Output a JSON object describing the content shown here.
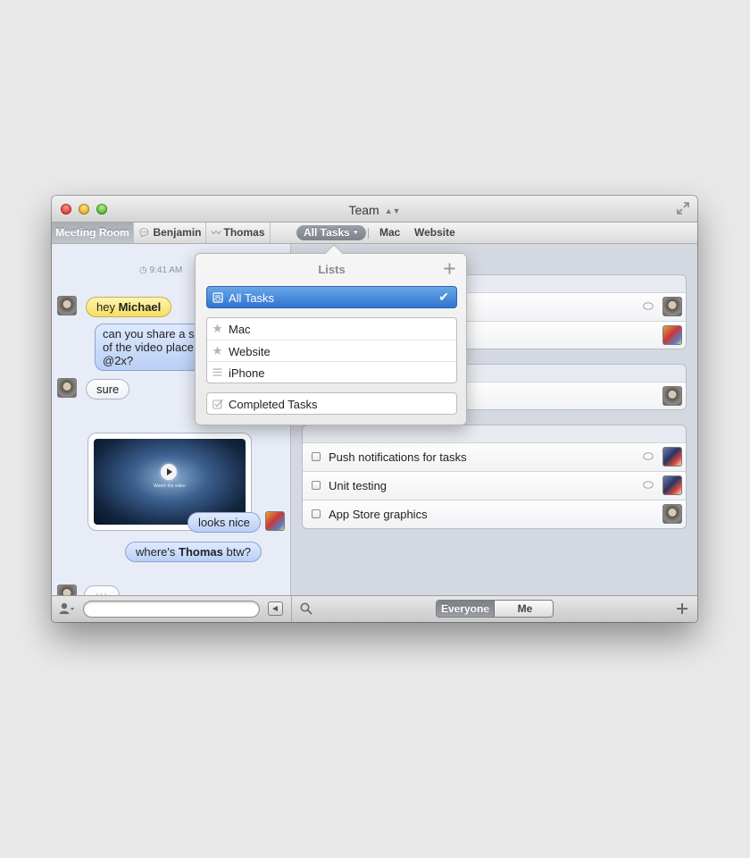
{
  "window": {
    "title": "Team"
  },
  "chat_tabs": [
    {
      "label": "Meeting Room",
      "icon": null
    },
    {
      "label": "Benjamin",
      "icon": "speech-bubble-icon"
    },
    {
      "label": "Thomas",
      "icon": "activity-icon"
    }
  ],
  "chat": {
    "timestamp": "9:41 AM",
    "messages": [
      {
        "from": "other",
        "parts": [
          "hey ",
          "Michael"
        ],
        "style": "yellow"
      },
      {
        "from": "me",
        "lines": [
          "can you share a sc",
          "of the video place",
          "@2x?"
        ],
        "style": "blue"
      },
      {
        "from": "other",
        "parts": [
          "sure"
        ],
        "style": "white"
      },
      {
        "from": "other",
        "type": "video",
        "caption": "Watch the video"
      },
      {
        "from": "me",
        "parts": [
          "looks nice"
        ],
        "style": "blue"
      },
      {
        "from": "me",
        "parts": [
          "where's ",
          "Thomas",
          " btw?"
        ],
        "style": "blue"
      },
      {
        "from": "other",
        "type": "typing",
        "text": "···"
      }
    ],
    "input_placeholder": ""
  },
  "task_tabs": {
    "filter": "All Tasks",
    "lists": [
      "Mac",
      "Website"
    ]
  },
  "tasks": {
    "visible": [
      {
        "label": "Push notifications for tasks",
        "has_comment": true,
        "avatar": "blue"
      },
      {
        "label": "Unit testing",
        "has_comment": true,
        "avatar": "blue"
      },
      {
        "label": "App Store graphics",
        "has_comment": false,
        "avatar": "gray"
      }
    ]
  },
  "filter_segment": {
    "options": [
      "Everyone",
      "Me"
    ],
    "selected": "Everyone"
  },
  "lists_popover": {
    "title": "Lists",
    "selected": "All Tasks",
    "items": [
      {
        "label": "Mac",
        "icon": "star-icon"
      },
      {
        "label": "Website",
        "icon": "star-icon"
      },
      {
        "label": "iPhone",
        "icon": "lines-icon"
      }
    ],
    "completed": "Completed Tasks"
  },
  "colors": {
    "accent_blue": "#2f74cf",
    "bubble_yellow": "#f4df63",
    "bubble_blue": "#b9cff5"
  }
}
